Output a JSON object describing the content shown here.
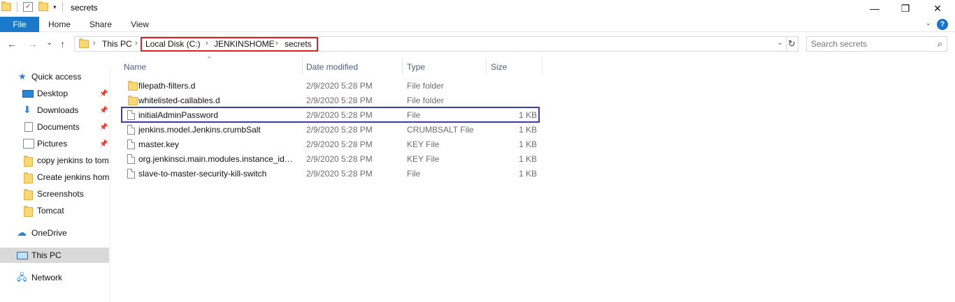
{
  "window": {
    "title": "secrets",
    "minimize_glyph": "—",
    "maximize_glyph": "❐",
    "close_glyph": "✕"
  },
  "ribbon": {
    "tabs": [
      "File",
      "Home",
      "Share",
      "View"
    ],
    "help_glyph": "?"
  },
  "nav": {
    "back_glyph": "←",
    "forward_glyph": "→",
    "recent_glyph": "⌄",
    "up_glyph": "↑",
    "breadcrumbs": [
      "This PC",
      "Local Disk (C:)",
      "JENKINSHOME",
      "secrets"
    ],
    "refresh_glyph": "↻",
    "search_placeholder": "Search secrets"
  },
  "sidebar": {
    "items": [
      {
        "label": "Quick access",
        "icon": "star-icon"
      },
      {
        "label": "Desktop",
        "icon": "desktop-icon",
        "pinned": true
      },
      {
        "label": "Downloads",
        "icon": "download-icon",
        "pinned": true
      },
      {
        "label": "Documents",
        "icon": "documents-icon",
        "pinned": true
      },
      {
        "label": "Pictures",
        "icon": "pictures-icon",
        "pinned": true
      },
      {
        "label": "copy jenkins to tom",
        "icon": "folder-icon"
      },
      {
        "label": "Create jenkins hom",
        "icon": "folder-icon"
      },
      {
        "label": "Screenshots",
        "icon": "folder-icon"
      },
      {
        "label": "Tomcat",
        "icon": "folder-icon"
      },
      {
        "label": "OneDrive",
        "icon": "cloud-icon"
      },
      {
        "label": "This PC",
        "icon": "computer-icon",
        "selected": true
      },
      {
        "label": "Network",
        "icon": "network-icon"
      }
    ]
  },
  "columns": {
    "name": "Name",
    "date": "Date modified",
    "type": "Type",
    "size": "Size"
  },
  "files": [
    {
      "name": "filepath-filters.d",
      "date": "2/9/2020 5:28 PM",
      "type": "File folder",
      "size": "",
      "icon": "folder-icon"
    },
    {
      "name": "whitelisted-callables.d",
      "date": "2/9/2020 5:28 PM",
      "type": "File folder",
      "size": "",
      "icon": "folder-icon"
    },
    {
      "name": "initialAdminPassword",
      "date": "2/9/2020 5:28 PM",
      "type": "File",
      "size": "1 KB",
      "icon": "file-icon",
      "highlighted": true
    },
    {
      "name": "jenkins.model.Jenkins.crumbSalt",
      "date": "2/9/2020 5:28 PM",
      "type": "CRUMBSALT File",
      "size": "1 KB",
      "icon": "file-icon"
    },
    {
      "name": "master.key",
      "date": "2/9/2020 5:28 PM",
      "type": "KEY File",
      "size": "1 KB",
      "icon": "file-icon"
    },
    {
      "name": "org.jenkinsci.main.modules.instance_ide...",
      "date": "2/9/2020 5:28 PM",
      "type": "KEY File",
      "size": "1 KB",
      "icon": "file-icon"
    },
    {
      "name": "slave-to-master-security-kill-switch",
      "date": "2/9/2020 5:28 PM",
      "type": "File",
      "size": "1 KB",
      "icon": "file-icon"
    }
  ],
  "colors": {
    "file_tab": "#1979ca",
    "breadcrumb_highlight": "#e41e26",
    "row_highlight": "#3c3ca3",
    "selected_nav": "#d9d9d9"
  }
}
